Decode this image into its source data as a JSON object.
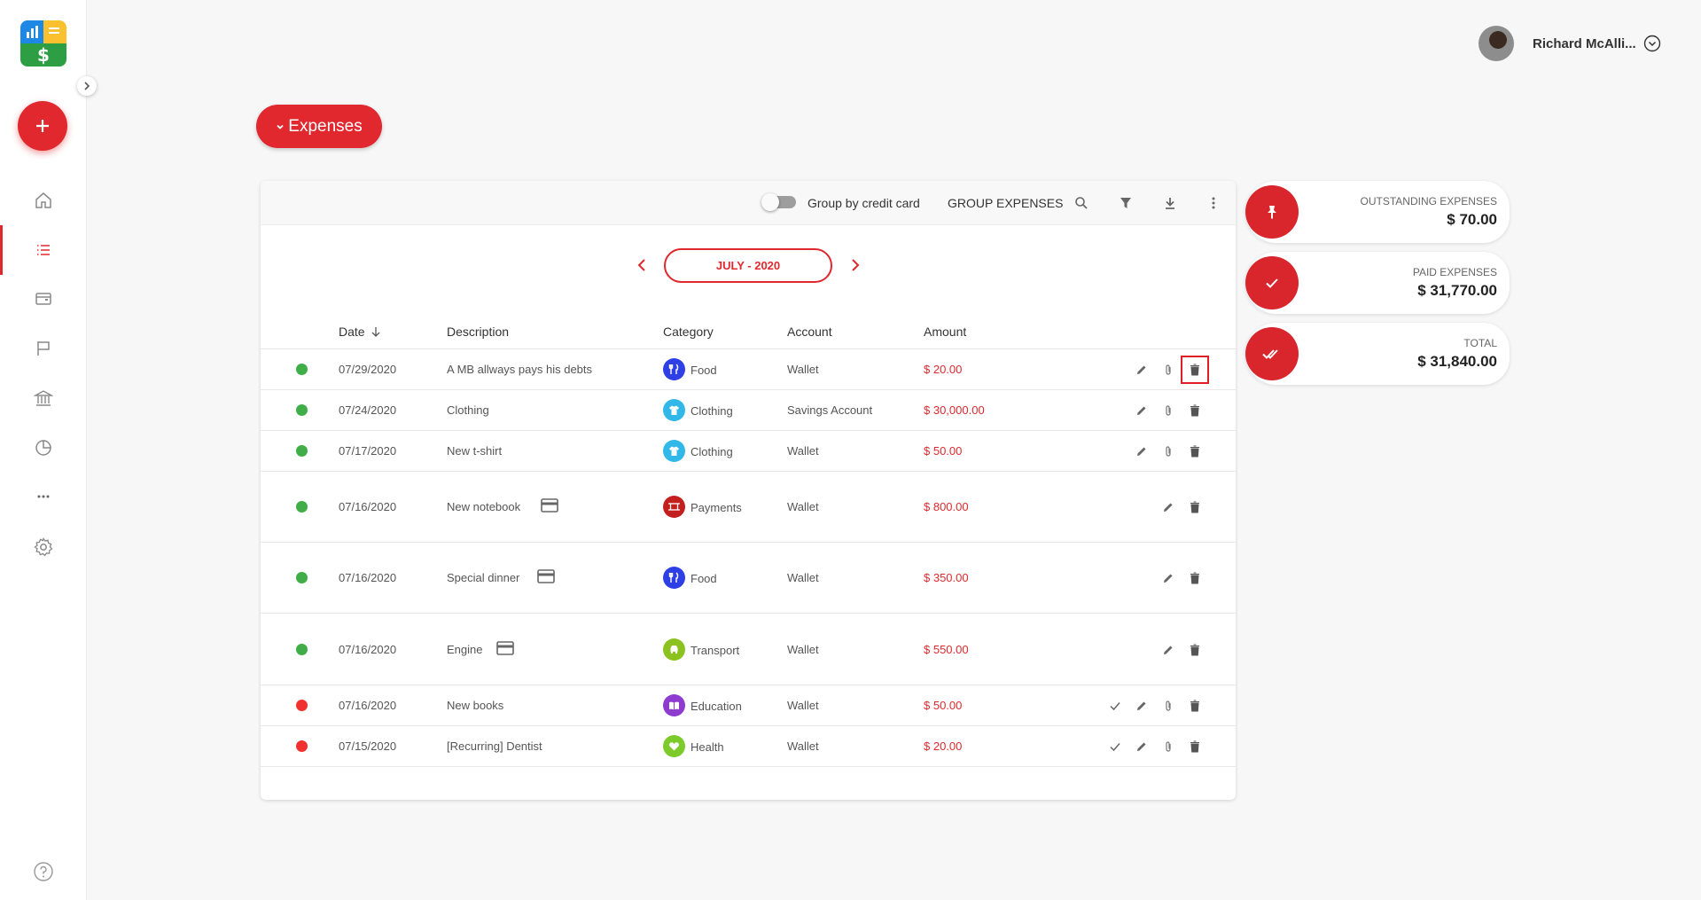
{
  "user": {
    "name": "Richard McAlli..."
  },
  "page": {
    "section_button": "Expenses"
  },
  "toolbar": {
    "toggle_label": "Group by credit card",
    "group_button": "GROUP EXPENSES"
  },
  "month": {
    "label": "JULY - 2020"
  },
  "table": {
    "headers": {
      "date": "Date",
      "description": "Description",
      "category": "Category",
      "account": "Account",
      "amount": "Amount"
    },
    "rows": [
      {
        "date": "07/29/2020",
        "description": "A MB allways pays his debts",
        "category": "Food",
        "account": "Wallet",
        "amount": "$ 20.00"
      },
      {
        "date": "07/24/2020",
        "description": "Clothing",
        "category": "Clothing",
        "account": "Savings Account",
        "amount": "$ 30,000.00"
      },
      {
        "date": "07/17/2020",
        "description": "New t-shirt",
        "category": "Clothing",
        "account": "Wallet",
        "amount": "$ 50.00"
      },
      {
        "date": "07/16/2020",
        "description": "New notebook",
        "category": "Payments",
        "account": "Wallet",
        "amount": "$ 800.00"
      },
      {
        "date": "07/16/2020",
        "description": "Special dinner",
        "category": "Food",
        "account": "Wallet",
        "amount": "$ 350.00"
      },
      {
        "date": "07/16/2020",
        "description": "Engine",
        "category": "Transport",
        "account": "Wallet",
        "amount": "$ 550.00"
      },
      {
        "date": "07/16/2020",
        "description": "New books",
        "category": "Education",
        "account": "Wallet",
        "amount": "$ 50.00"
      },
      {
        "date": "07/15/2020",
        "description": "[Recurring] Dentist",
        "category": "Health",
        "account": "Wallet",
        "amount": "$ 20.00"
      }
    ]
  },
  "summary": {
    "outstanding": {
      "label": "OUTSTANDING EXPENSES",
      "value": "$ 70.00"
    },
    "paid": {
      "label": "PAID EXPENSES",
      "value": "$ 31,770.00"
    },
    "total": {
      "label": "TOTAL",
      "value": "$ 31,840.00"
    }
  },
  "colors": {
    "accent": "#e0282e",
    "status_paid": "#3fae49",
    "status_pending": "#f0312f",
    "food": "#2f3fe6",
    "clothing": "#31b7e8",
    "payments": "#c41f1f",
    "transport": "#8cc21f",
    "education": "#8e3ccf",
    "health": "#7ccb2a"
  }
}
